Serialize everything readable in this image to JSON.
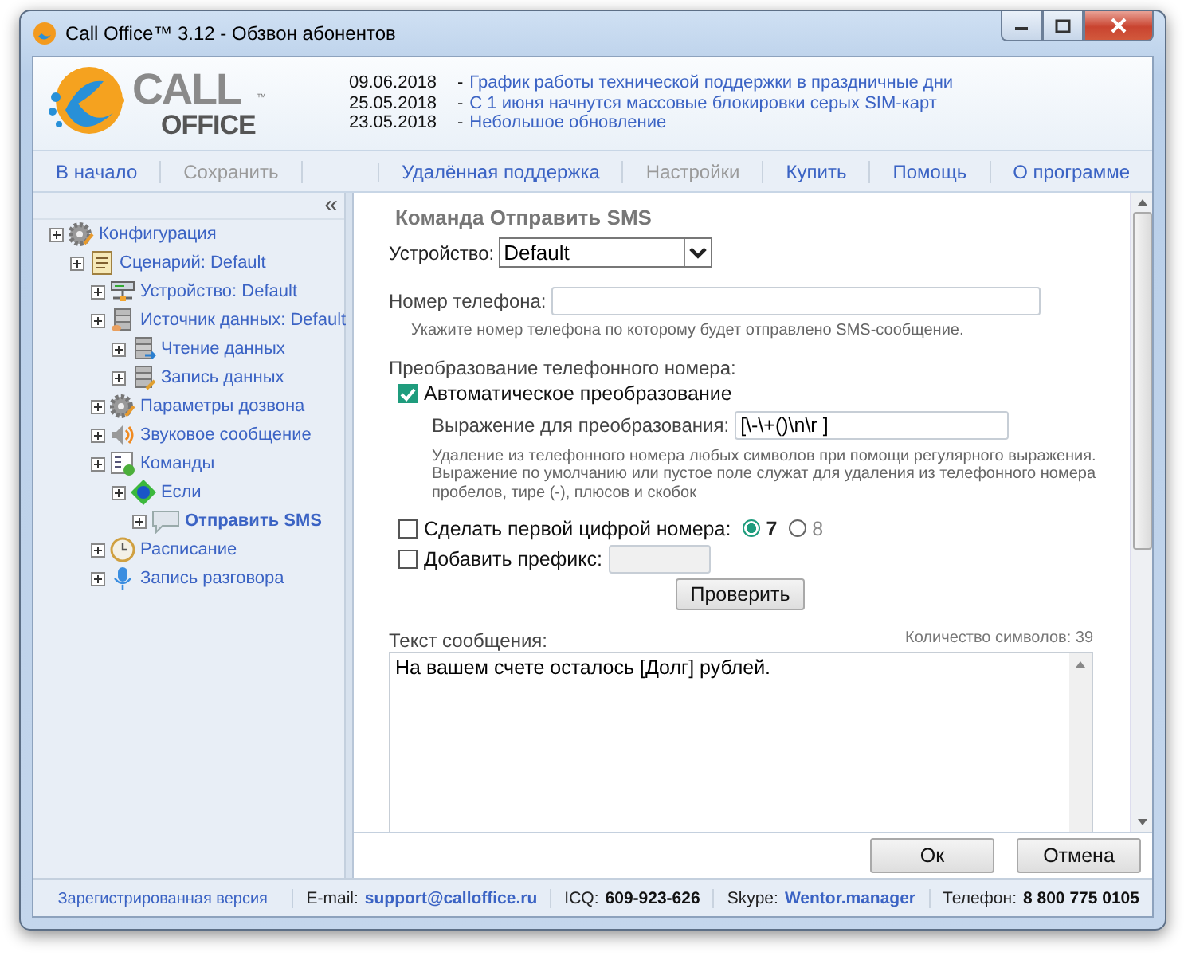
{
  "window": {
    "title": "Call Office™ 3.12 - Обзвон абонентов"
  },
  "logo": {
    "line1": "CALL",
    "line2": "OFFICE",
    "mark": "™"
  },
  "news": [
    {
      "date": "09.06.2018",
      "dash": "-",
      "text": "График работы технической поддержки в праздничные дни"
    },
    {
      "date": "25.05.2018",
      "dash": "-",
      "text": "С 1 июня начнутся массовые блокировки серых SIM-карт"
    },
    {
      "date": "23.05.2018",
      "dash": "-",
      "text": "Небольшое обновление"
    }
  ],
  "nav_left": [
    {
      "label": "В начало",
      "disabled": false
    },
    {
      "label": "Сохранить",
      "disabled": true
    }
  ],
  "nav_right": [
    {
      "label": "Удалённая поддержка",
      "disabled": false
    },
    {
      "label": "Настройки",
      "disabled": true
    },
    {
      "label": "Купить",
      "disabled": false
    },
    {
      "label": "Помощь",
      "disabled": false
    },
    {
      "label": "О программе",
      "disabled": false
    }
  ],
  "sidebar": {
    "collapse": "«",
    "tree": [
      {
        "label": "Конфигурация",
        "kind": "gear",
        "selected": false,
        "children": [
          {
            "label": "Сценарий: Default",
            "kind": "scroll",
            "selected": false,
            "children": [
              {
                "label": "Устройство: Default",
                "kind": "device",
                "selected": false
              },
              {
                "label": "Источник данных: Default",
                "kind": "database",
                "selected": false,
                "children": [
                  {
                    "label": "Чтение данных",
                    "kind": "db-read",
                    "selected": false
                  },
                  {
                    "label": "Запись данных",
                    "kind": "db-write",
                    "selected": false
                  }
                ]
              },
              {
                "label": "Параметры дозвона",
                "kind": "gear",
                "selected": false
              },
              {
                "label": "Звуковое сообщение",
                "kind": "speaker",
                "selected": false
              },
              {
                "label": "Команды",
                "kind": "commands",
                "selected": false,
                "children": [
                  {
                    "label": "Если",
                    "kind": "condition",
                    "selected": false,
                    "children": [
                      {
                        "label": "Отправить SMS",
                        "kind": "sms",
                        "selected": true
                      }
                    ]
                  }
                ]
              },
              {
                "label": "Расписание",
                "kind": "clock",
                "selected": false
              },
              {
                "label": "Запись разговора",
                "kind": "mic",
                "selected": false
              }
            ]
          }
        ]
      }
    ]
  },
  "form": {
    "title": "Команда Отправить SMS",
    "device": {
      "label": "Устройство:",
      "value": "Default"
    },
    "phone": {
      "label": "Номер телефона:",
      "hint": "Укажите номер телефона по которому будет отправлено SMS-сообщение."
    },
    "conversion_title": "Преобразование телефонного номера:",
    "auto": {
      "label": "Автоматическое преобразование",
      "checked": true
    },
    "expression": {
      "label": "Выражение для преобразования:",
      "value": "[\\-\\+()\\n\\r ]",
      "hint": "Удаление из телефонного номера любых символов при помощи регулярного выражения. Выражение по умолчанию или пустое поле служат для удаления из телефонного номера пробелов, тире (-), плюсов и скобок"
    },
    "first_digit": {
      "label": "Сделать первой цифрой номера:",
      "checked": false,
      "options": [
        {
          "label": "7",
          "selected": true
        },
        {
          "label": "8",
          "selected": false
        }
      ]
    },
    "prefix": {
      "label": "Добавить префикс:",
      "checked": false
    },
    "check_button": "Проверить",
    "message": {
      "label": "Текст сообщения:",
      "counter": "Количество символов: 39",
      "value": "На вашем счете осталось [Долг] рублей."
    }
  },
  "buttons": [
    "Ок",
    "Отмена"
  ],
  "status_bar": {
    "registered": "Зарегистрированная версия",
    "items": [
      {
        "label": "E-mail:",
        "value": "support@calloffice.ru",
        "kind": "link"
      },
      {
        "label": "ICQ:",
        "value": "609-923-626",
        "kind": "text"
      },
      {
        "label": "Skype:",
        "value": "Wentor.manager",
        "kind": "link"
      },
      {
        "label": "Телефон:",
        "value": "8 800 775 0105",
        "kind": "text"
      }
    ]
  }
}
